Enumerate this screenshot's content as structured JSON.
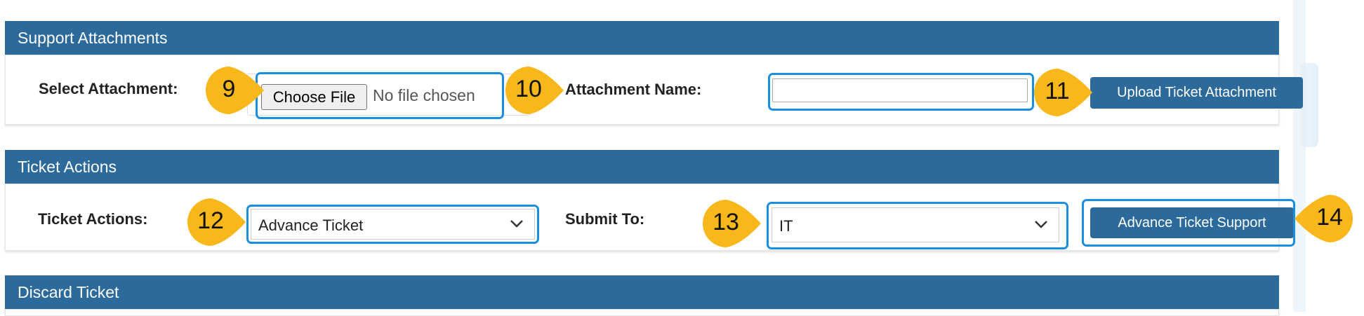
{
  "support_attachments": {
    "header": "Support Attachments",
    "select_label": "Select Attachment:",
    "choose_file_label": "Choose File",
    "no_file_text": "No file chosen",
    "attachment_name_label": "Attachment Name:",
    "attachment_name_value": "",
    "upload_button": "Upload Ticket Attachment"
  },
  "ticket_actions": {
    "header": "Ticket Actions",
    "actions_label": "Ticket Actions:",
    "actions_selected": "Advance Ticket",
    "submit_to_label": "Submit To:",
    "submit_to_selected": "IT",
    "advance_button": "Advance Ticket Support"
  },
  "discard_ticket": {
    "header": "Discard Ticket"
  },
  "callouts": [
    "9",
    "10",
    "11",
    "12",
    "13",
    "14"
  ],
  "colors": {
    "header_bg": "#2c6a9b",
    "button_bg": "#2c6a9b",
    "highlight": "#1a8fe0",
    "callout": "#f8b81c"
  }
}
